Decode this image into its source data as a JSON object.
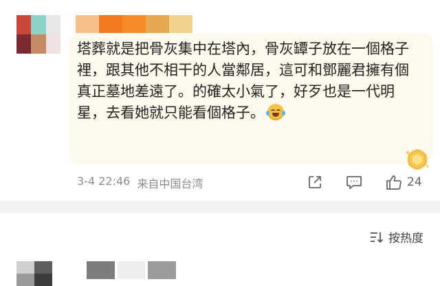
{
  "comment": {
    "text": "塔葬就是把骨灰集中在塔內，骨灰罈子放在一個格子裡，跟其他不相干的人當鄰居，這可和鄧麗君擁有個真正墓地差遠了。的確太小氣了，好歹也是一代明星，去看她就只能看個格子。",
    "emoji": "laughing-crying-emoji",
    "timestamp": "3-4 22:46",
    "location": "来自中国台湾",
    "likes": "24",
    "avatar_colors": [
      "#c9473a",
      "#8ed1c6",
      "#e8e8e8",
      "#7b2a2f",
      "#c58a67",
      "#f0e2e2"
    ],
    "username_colors": [
      "#f5c08a",
      "#f07a1d",
      "#f58a26",
      "#e7a650",
      "#f3d38c"
    ],
    "bubble_color": "#fdf9ec"
  },
  "actions": {
    "share_icon": "share-icon",
    "reply_icon": "comment-icon",
    "like_icon": "thumbs-up-icon",
    "badge_icon": "diamond-medal-icon"
  },
  "sort": {
    "label": "按热度",
    "icon": "sort-icon"
  },
  "next_comment": {
    "avatar_colors": [
      "#cfcfcf",
      "#5e5e5e",
      "#9a9a9a",
      "#3d3d3d"
    ],
    "username_colors": [
      "#7d7d7d",
      "#eeeeee",
      "#9c9c9c"
    ]
  }
}
